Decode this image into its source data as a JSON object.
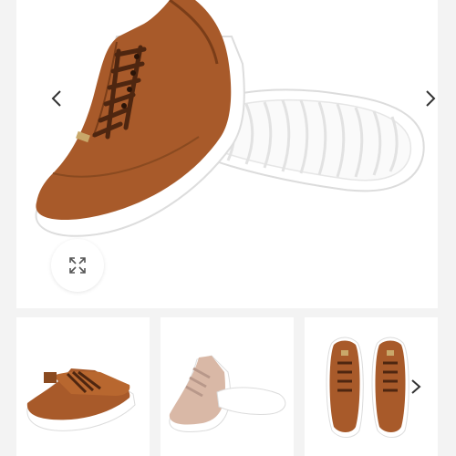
{
  "gallery": {
    "main_image_alt": "",
    "nav": {
      "prev_icon": "chevron-left-icon",
      "next_icon": "chevron-right-icon"
    },
    "zoom_icon": "expand-icon",
    "thumbnails": [
      {
        "name": "thumbnail-pair-side"
      },
      {
        "name": "thumbnail-beige-sneaker"
      },
      {
        "name": "thumbnail-pair-top"
      }
    ],
    "thumb_next_icon": "chevron-right-icon"
  },
  "colors": {
    "leather": "#a85a2a",
    "leather_dark": "#7a3d18",
    "sole": "#ffffff",
    "laces": "#5a2e12",
    "beige": "#d9b8a6"
  }
}
